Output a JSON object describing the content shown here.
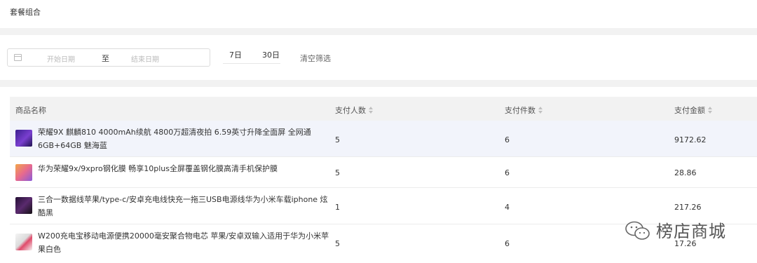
{
  "page": {
    "title": "套餐组合"
  },
  "filter": {
    "start_placeholder": "开始日期",
    "separator": "至",
    "end_placeholder": "结束日期",
    "quick_7": "7日",
    "quick_30": "30日",
    "clear": "清空筛选"
  },
  "table": {
    "headers": [
      "商品名称",
      "支付人数",
      "支付件数",
      "支付金额"
    ],
    "rows": [
      {
        "name": "荣耀9X 麒麟810 4000mAh续航 4800万超清夜拍 6.59英寸升降全面屏 全网通6GB+64GB 魅海蓝",
        "buyers": "5",
        "pieces": "6",
        "amount": "9172.62"
      },
      {
        "name": "华为荣耀9x/9xpro钢化膜 畅享10plus全屏覆盖钢化膜高清手机保护膜",
        "buyers": "5",
        "pieces": "6",
        "amount": "28.86"
      },
      {
        "name": "三合一数据线苹果/type-c/安卓充电线快充一拖三USB电源线华为小米车载iphone 炫酷黑",
        "buyers": "1",
        "pieces": "4",
        "amount": "217.26"
      },
      {
        "name": "W200充电宝移动电源便携20000毫安聚合物电芯 苹果/安卓双输入适用于华为小米苹果白色",
        "buyers": "5",
        "pieces": "6",
        "amount": "17.26"
      }
    ]
  },
  "watermark": {
    "text": "榜店商城"
  },
  "colors": {
    "highlight_row": "#f2f4fb",
    "header_bg": "#f2f2f2"
  },
  "icons": [
    "calendar-icon",
    "sort-icon",
    "wechat-icon"
  ]
}
